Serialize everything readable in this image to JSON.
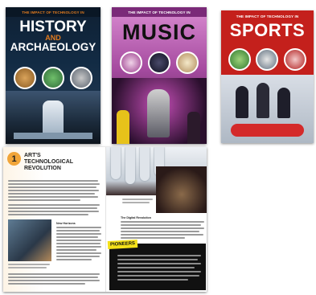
{
  "covers": [
    {
      "series": "THE IMPACT OF TECHNOLOGY IN",
      "title_line1": "HISTORY",
      "title_line2": "AND",
      "title_line3": "ARCHAEOLOGY",
      "bg_top": "#0f2033",
      "accent": "#e07a1e"
    },
    {
      "series": "THE IMPACT OF TECHNOLOGY IN",
      "title_line1": "MUSIC",
      "bg_top": "#c76cbf",
      "accent": "#f7e34b"
    },
    {
      "series": "THE IMPACT OF TECHNOLOGY IN",
      "title_line1": "SPORTS",
      "bg_top": "#c4201c",
      "accent": "#ffffff"
    }
  ],
  "spread": {
    "chapter_number": "1",
    "chapter_title_line1": "ART'S",
    "chapter_title_line2": "TECHNOLOGICAL",
    "chapter_title_line3": "REVOLUTION",
    "sub_heading_left": "New Horizons",
    "sub_heading_right": "The Digital Revolution",
    "pioneers_label": "PIONEERS",
    "pioneers_color": "#f4e11a"
  }
}
